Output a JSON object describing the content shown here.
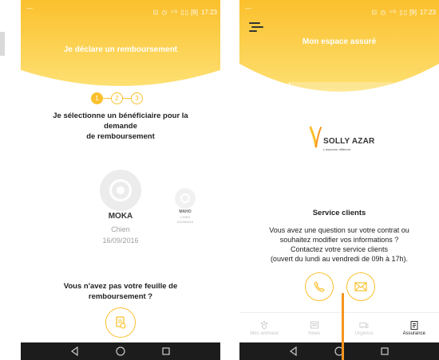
{
  "status_bar": {
    "icons_text": "⊡ ◷ ⁴ᴳ ▯▯",
    "battery": "[9]",
    "time": "17:23"
  },
  "left_screen": {
    "header_title": "Je déclare un remboursement",
    "stepper": [
      "1",
      "2",
      "3"
    ],
    "title_lines": [
      "Je sélectionne un bénéficiaire pour la",
      "demande",
      "de remboursement"
    ],
    "beneficiary_main": {
      "name": "MOKA",
      "species": "Chien",
      "date": "16/09/2016",
      "icon": "paw-icon"
    },
    "beneficiary_small": {
      "name": "MAHO",
      "species": "CHIEN",
      "date": "01/05/2016",
      "icon": "paw-icon"
    },
    "no_sheet_lines": [
      "Vous n'avez pas votre feuille de",
      "remboursement ?"
    ],
    "no_sheet_button_icon": "document-icon"
  },
  "right_screen": {
    "header_title": "Mon espace assuré",
    "search_value": "",
    "logo": {
      "text": "SOLLY AZAR",
      "tagline": "L'assureur différent"
    },
    "service_title": "Service clients",
    "service_lines": [
      "Vous avez une question sur votre contrat ou",
      "souhaitez modifier vos informations ?",
      "Contactez votre service clients",
      "(ouvert du lundi au vendredi de 09h à 17h)."
    ],
    "contact_buttons": [
      {
        "icon": "phone-icon"
      },
      {
        "icon": "mail-icon"
      }
    ],
    "tabs": [
      {
        "label": "Mes animaux",
        "icon": "paw-icon",
        "active": false
      },
      {
        "label": "News",
        "icon": "news-icon",
        "active": false
      },
      {
        "label": "Urgence",
        "icon": "ambulance-icon",
        "active": false
      },
      {
        "label": "Assurance",
        "icon": "clipboard-icon",
        "active": true
      }
    ]
  },
  "nav_bar": {
    "buttons": [
      {
        "icon": "back-icon"
      },
      {
        "icon": "home-icon"
      },
      {
        "icon": "recents-icon"
      }
    ]
  },
  "colors": {
    "accent": "#fbc02d",
    "header_top": "#fbc02d",
    "header_bottom": "#fde072",
    "nav_bar": "#1c1c1c",
    "pointer": "#f7941d"
  }
}
